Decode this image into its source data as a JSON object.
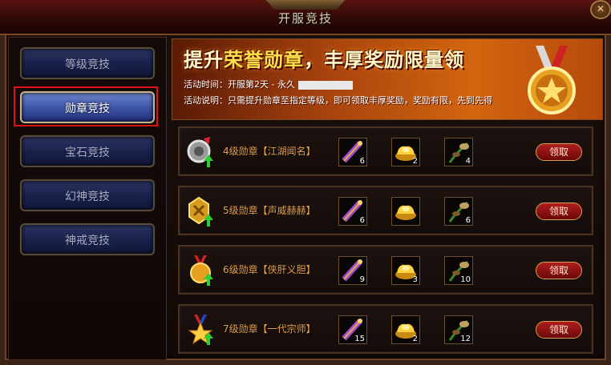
{
  "window": {
    "title": "开服竞技",
    "close_label": "✕"
  },
  "nav": {
    "items": [
      {
        "label": "等级竞技",
        "active": false
      },
      {
        "label": "勋章竞技",
        "active": true
      },
      {
        "label": "宝石竞技",
        "active": false
      },
      {
        "label": "幻神竞技",
        "active": false
      },
      {
        "label": "神戒竞技",
        "active": false
      }
    ]
  },
  "banner": {
    "title_part1": "提升",
    "title_highlight": "荣誉勋章",
    "title_part2": "，丰厚奖励限量领",
    "time_label": "活动时间：",
    "time_value": "开服第2天 - 永久",
    "desc_label": "活动说明：",
    "desc_value": "只需提升勋章至指定等级，即可领取丰厚奖励，奖励有限，先到先得"
  },
  "rewards": [
    {
      "label": "4级勋章【江湖闻名】",
      "items": [
        {
          "icon": "scroll-icon",
          "qty": "6"
        },
        {
          "icon": "gold-ingot-icon",
          "qty": "2"
        },
        {
          "icon": "herb-icon",
          "qty": "4"
        }
      ],
      "button": "领取"
    },
    {
      "label": "5级勋章【声威赫赫】",
      "items": [
        {
          "icon": "scroll-icon",
          "qty": "6"
        },
        {
          "icon": "gold-ingot-icon",
          "qty": ""
        },
        {
          "icon": "herb-icon",
          "qty": "6"
        }
      ],
      "button": "领取"
    },
    {
      "label": "6级勋章【侠肝义胆】",
      "items": [
        {
          "icon": "scroll-icon",
          "qty": "9"
        },
        {
          "icon": "gold-ingot-icon",
          "qty": "3"
        },
        {
          "icon": "herb-icon",
          "qty": "10"
        }
      ],
      "button": "领取"
    },
    {
      "label": "7级勋章【一代宗师】",
      "items": [
        {
          "icon": "scroll-icon",
          "qty": "15"
        },
        {
          "icon": "gold-ingot-icon",
          "qty": "2"
        },
        {
          "icon": "herb-icon",
          "qty": "12"
        }
      ],
      "button": "领取"
    }
  ],
  "colors": {
    "accent": "#e8a24a",
    "active_nav": "#3f56a8",
    "claim": "#b01e1e",
    "highlight_border": "#e01010"
  }
}
